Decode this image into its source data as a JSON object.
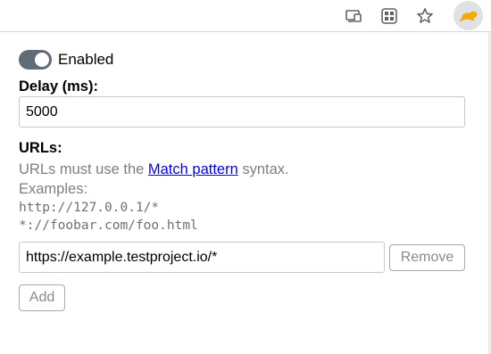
{
  "toolbar": {
    "icons": [
      "cast-icon",
      "apps-grid-icon",
      "bookmark-star-icon",
      "extension-icon"
    ]
  },
  "popup": {
    "toggle": {
      "label": "Enabled",
      "on": true
    },
    "delay": {
      "label": "Delay (ms):",
      "value": "5000"
    },
    "urls": {
      "label": "URLs:",
      "hint_prefix": "URLs must use the ",
      "hint_link": "Match pattern",
      "hint_suffix": " syntax.",
      "examples_label": "Examples:",
      "example_1": "http://127.0.0.1/*",
      "example_2": "*://foobar.com/foo.html",
      "entries": [
        {
          "value": "https://example.testproject.io/*",
          "remove_label": "Remove"
        }
      ],
      "add_label": "Add"
    }
  },
  "colors": {
    "accent_link": "#0000ee",
    "toggle_track": "#5f6b77",
    "hint_text": "#7a7f86"
  }
}
